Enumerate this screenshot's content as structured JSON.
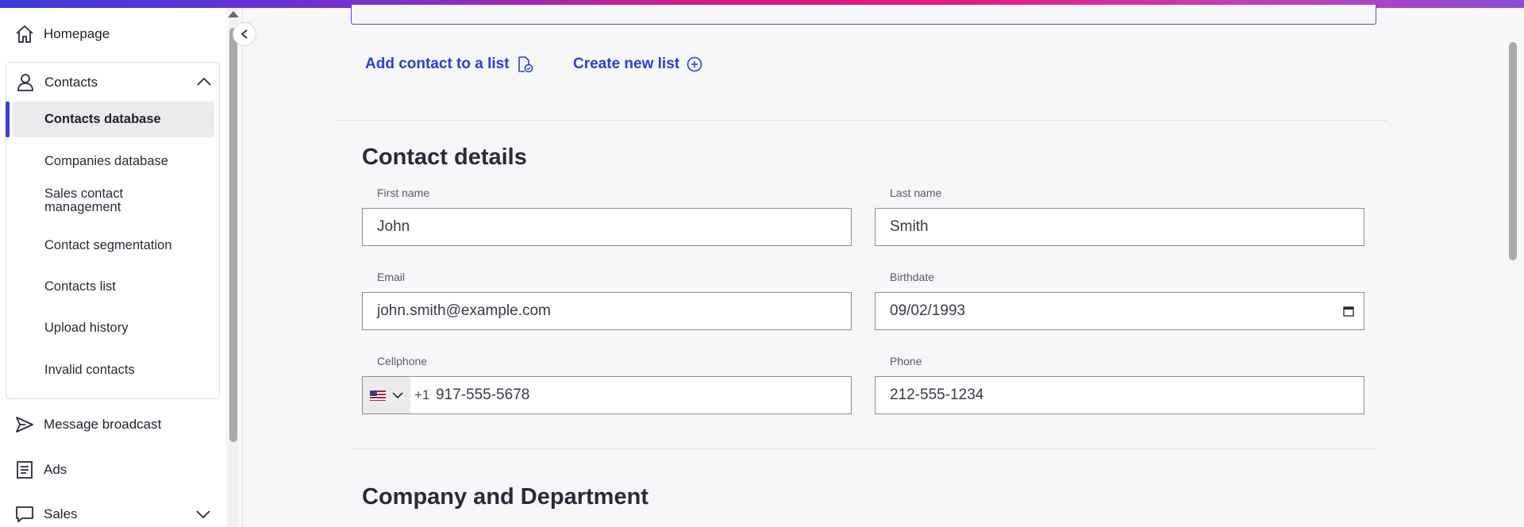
{
  "sidebar": {
    "homepage": "Homepage",
    "contacts": "Contacts",
    "sub_items": [
      "Contacts database",
      "Companies database",
      "Sales contact management",
      "Contact segmentation",
      "Contacts list",
      "Upload history",
      "Invalid contacts"
    ],
    "message_broadcast": "Message broadcast",
    "ads": "Ads",
    "sales": "Sales"
  },
  "actions": {
    "add_to_list": "Add contact to a list",
    "create_list": "Create new list"
  },
  "contact_details": {
    "title": "Contact details",
    "first_name_label": "First name",
    "first_name": "John",
    "last_name_label": "Last name",
    "last_name": "Smith",
    "email_label": "Email",
    "email": "john.smith@example.com",
    "birthdate_label": "Birthdate",
    "birthdate": "09/02/1993",
    "cellphone_label": "Cellphone",
    "cellphone_code": "+1",
    "cellphone": "917-555-5678",
    "phone_label": "Phone",
    "phone": "212-555-1234"
  },
  "company_section": {
    "title": "Company and Department"
  },
  "colors": {
    "accent": "#3b3bd6",
    "link": "#2e3ed6"
  }
}
